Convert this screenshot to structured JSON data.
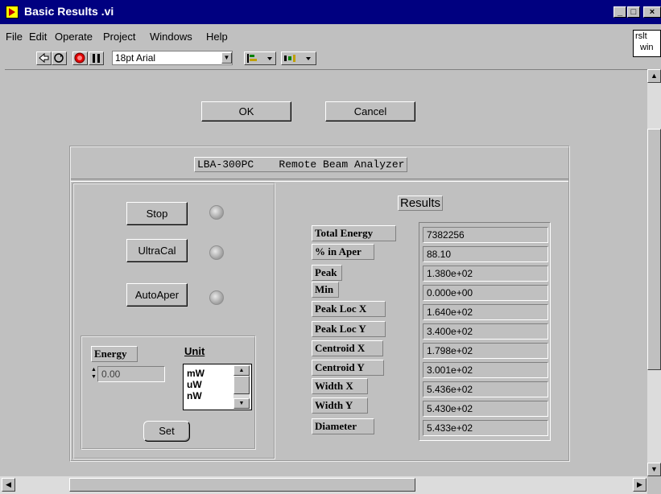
{
  "window": {
    "title": "Basic Results .vi",
    "min_label": "_",
    "max_label": "□",
    "close_label": "×"
  },
  "menu": [
    "File",
    "Edit",
    "Operate",
    "Project",
    "Windows",
    "Help"
  ],
  "rslt_box": {
    "line1": "rslt",
    "line2": "win"
  },
  "toolbar": {
    "font": "18pt Arial"
  },
  "buttons": {
    "ok": "OK",
    "cancel": "Cancel",
    "stop": "Stop",
    "ultracal": "UltraCal",
    "autoaper": "AutoAper",
    "set": "Set"
  },
  "banner": "LBA-300PC    Remote Beam Analyzer",
  "results": {
    "title": "Results",
    "rows": [
      {
        "label": "Total Energy",
        "value": "7382256"
      },
      {
        "label": "% in Aper",
        "value": "88.10"
      },
      {
        "label": "Peak",
        "value": "1.380e+02"
      },
      {
        "label": "Min",
        "value": "0.000e+00"
      },
      {
        "label": "Peak Loc X",
        "value": "1.640e+02"
      },
      {
        "label": "Peak Loc Y",
        "value": "3.400e+02"
      },
      {
        "label": "Centroid X",
        "value": "1.798e+02"
      },
      {
        "label": "Centroid Y",
        "value": "3.001e+02"
      },
      {
        "label": "Width X",
        "value": "5.436e+02"
      },
      {
        "label": "Width Y",
        "value": "5.430e+02"
      },
      {
        "label": "Diameter",
        "value": "5.433e+02"
      }
    ]
  },
  "energy": {
    "label": "Energy",
    "value": "0.00"
  },
  "unit": {
    "label": "Unit",
    "options": [
      "mW",
      "uW",
      "nW"
    ]
  }
}
